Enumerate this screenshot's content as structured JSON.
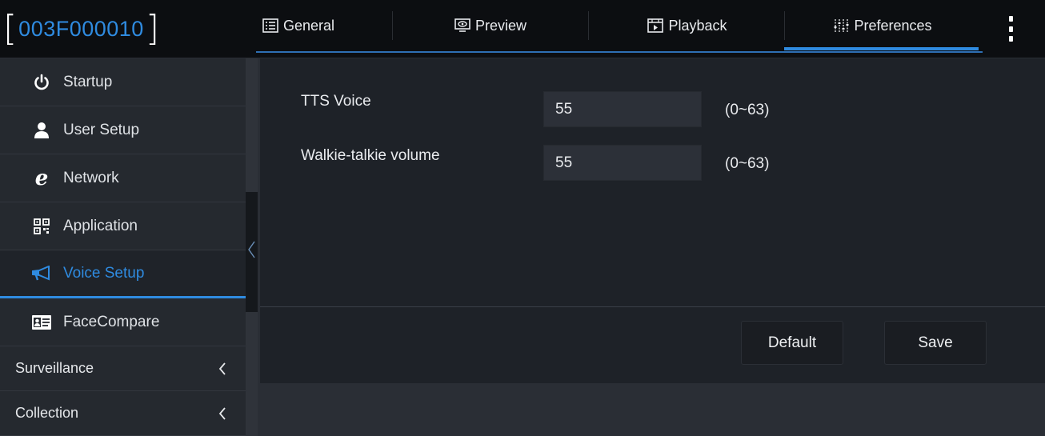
{
  "device": {
    "id": "003F000010"
  },
  "tabs": [
    {
      "label": "General",
      "icon": "general-icon"
    },
    {
      "label": "Preview",
      "icon": "preview-icon"
    },
    {
      "label": "Playback",
      "icon": "playback-icon"
    },
    {
      "label": "Preferences",
      "icon": "preferences-icon",
      "active": true
    }
  ],
  "sidebar": {
    "items": [
      {
        "label": "Startup",
        "icon": "power-icon"
      },
      {
        "label": "User Setup",
        "icon": "user-icon"
      },
      {
        "label": "Network",
        "icon": "network-icon"
      },
      {
        "label": "Application",
        "icon": "qr-code-icon"
      },
      {
        "label": "Voice Setup",
        "icon": "megaphone-icon",
        "active": true
      },
      {
        "label": "FaceCompare",
        "icon": "id-card-icon"
      }
    ],
    "groups": [
      {
        "label": "Surveillance"
      },
      {
        "label": "Collection"
      }
    ]
  },
  "form": {
    "tts": {
      "label": "TTS Voice",
      "value": "55",
      "range": "(0~63)"
    },
    "walkie": {
      "label": "Walkie-talkie volume",
      "value": "55",
      "range": "(0~63)"
    }
  },
  "buttons": {
    "default_label": "Default",
    "save_label": "Save"
  },
  "colors": {
    "accent": "#2f8be0",
    "topbar": "#0c0e11",
    "sidebar": "#25292f",
    "panel": "#1e2228"
  }
}
